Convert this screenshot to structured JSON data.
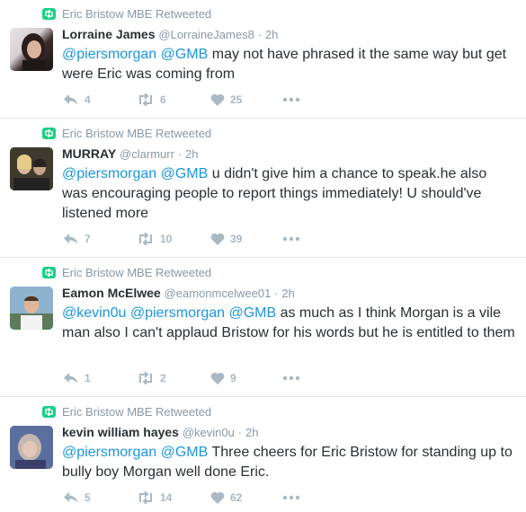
{
  "colors": {
    "retweet_green": "#19cf86",
    "link_blue": "#1b95e0",
    "muted": "#8899a6",
    "action_gray": "#aab8c2"
  },
  "tweets": [
    {
      "retweeted_by": "Eric Bristow MBE Retweeted",
      "fullname": "Lorraine James",
      "handle": "@LorraineJames8",
      "sep": "·",
      "time": "2h",
      "mentions": "@piersmorgan @GMB",
      "body": " may not have phrased it the same way but get were Eric was coming from",
      "reply_count": "4",
      "retweet_count": "6",
      "like_count": "25",
      "icons": [
        "retweet-icon",
        "reply-icon",
        "like-icon",
        "more-icon"
      ]
    },
    {
      "retweeted_by": "Eric Bristow MBE Retweeted",
      "fullname": "MURRAY",
      "handle": "@clarmurr",
      "sep": "·",
      "time": "2h",
      "mentions": "@piersmorgan @GMB",
      "body": " u didn't give him a chance to speak.he also was encouraging people to report things immediately! U should've listened more",
      "reply_count": "7",
      "retweet_count": "10",
      "like_count": "39"
    },
    {
      "retweeted_by": "Eric Bristow MBE Retweeted",
      "fullname": "Eamon McElwee",
      "handle": "@eamonmcelwee01",
      "sep": "·",
      "time": "2h",
      "mentions": "@kevin0u @piersmorgan @GMB",
      "body": " as much as I think Morgan is a vile man also I can't applaud Bristow for his words but he is entitled to them",
      "reply_count": "1",
      "retweet_count": "2",
      "like_count": "9"
    },
    {
      "retweeted_by": "Eric Bristow MBE Retweeted",
      "fullname": "kevin william hayes",
      "handle": "@kevin0u",
      "sep": "·",
      "time": "2h",
      "mentions": "@piersmorgan @GMB",
      "body": " Three cheers for Eric Bristow for standing up to bully boy Morgan well done Eric.",
      "reply_count": "5",
      "retweet_count": "14",
      "like_count": "62"
    }
  ]
}
